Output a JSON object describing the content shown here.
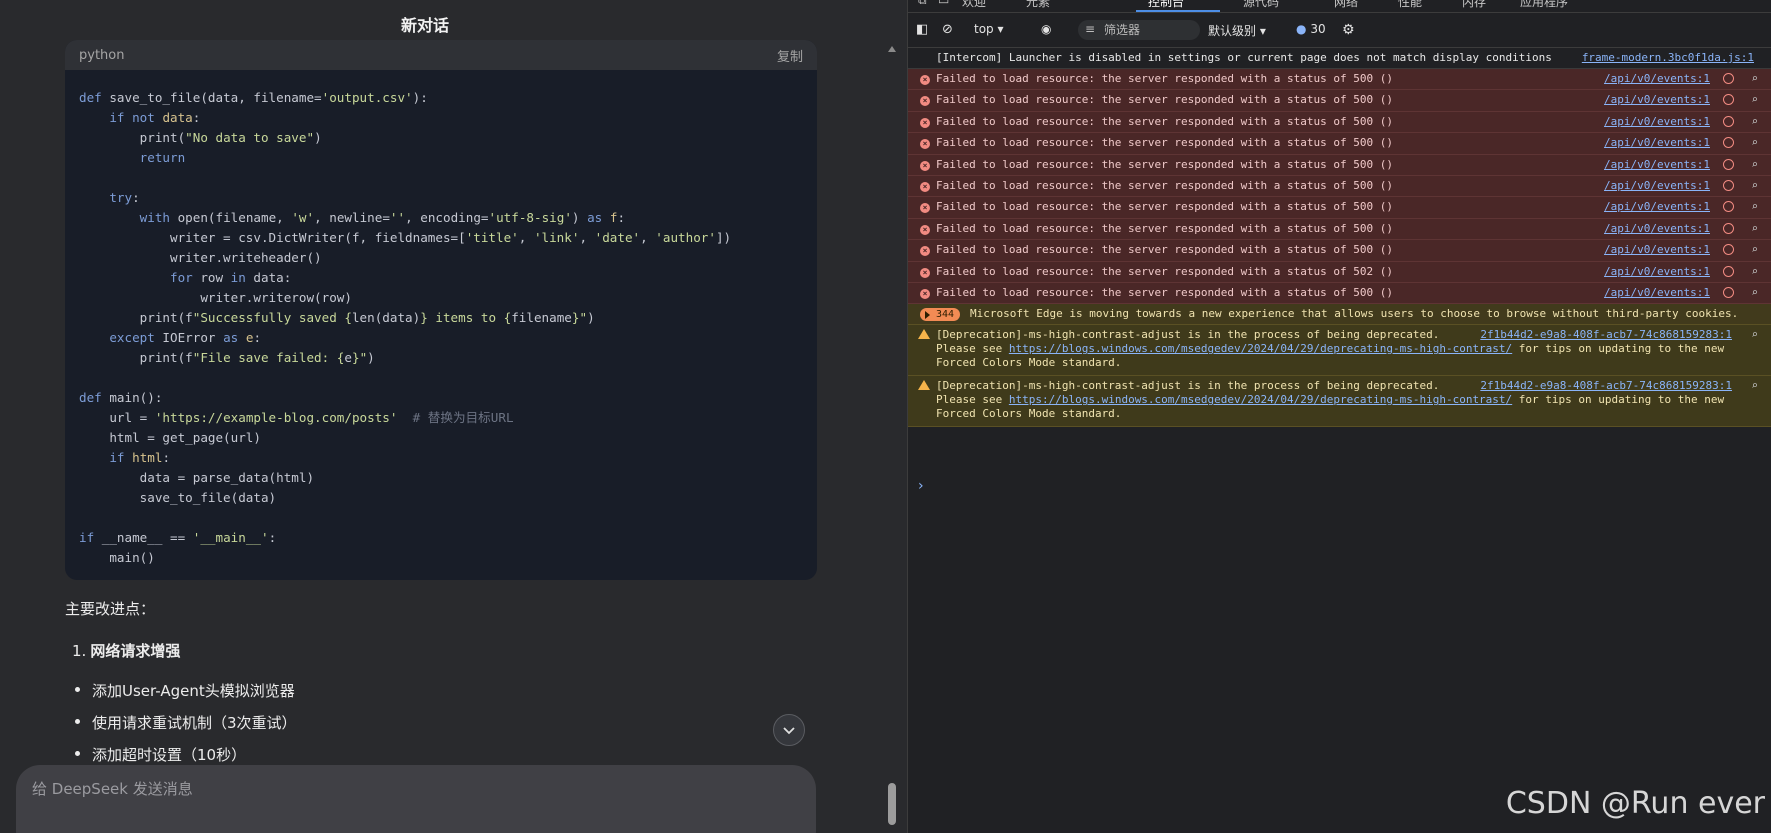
{
  "chat": {
    "title": "新对话",
    "code_block": {
      "language": "python",
      "copy_label": "复制"
    },
    "improvements_heading": "主要改进点：",
    "improvement_item": {
      "number": "1.",
      "text": "网络请求增强"
    },
    "bullets": [
      "添加User-Agent头模拟浏览器",
      "使用请求重试机制（3次重试）",
      "添加超时设置（10秒）"
    ],
    "composer_placeholder": "给 DeepSeek 发送消息"
  },
  "devtools": {
    "tabs": [
      "欢迎",
      "元素",
      "控制台",
      "源代码",
      "网络",
      "性能",
      "内存",
      "应用程序"
    ],
    "active_tab": "控制台",
    "toolbar": {
      "context": "top",
      "filter_placeholder": "筛选器",
      "level": "默认级别",
      "issues_count": "30"
    },
    "console": {
      "info": {
        "text": "[Intercom] Launcher is disabled in settings or current page does not match display conditions",
        "source": "frame-modern.3bc0f1da.js:1"
      },
      "errors": [
        {
          "text": "Failed to load resource: the server responded with a status of 500 ()",
          "source": "/api/v0/events:1"
        },
        {
          "text": "Failed to load resource: the server responded with a status of 500 ()",
          "source": "/api/v0/events:1"
        },
        {
          "text": "Failed to load resource: the server responded with a status of 500 ()",
          "source": "/api/v0/events:1"
        },
        {
          "text": "Failed to load resource: the server responded with a status of 500 ()",
          "source": "/api/v0/events:1"
        },
        {
          "text": "Failed to load resource: the server responded with a status of 500 ()",
          "source": "/api/v0/events:1"
        },
        {
          "text": "Failed to load resource: the server responded with a status of 500 ()",
          "source": "/api/v0/events:1"
        },
        {
          "text": "Failed to load resource: the server responded with a status of 500 ()",
          "source": "/api/v0/events:1"
        },
        {
          "text": "Failed to load resource: the server responded with a status of 500 ()",
          "source": "/api/v0/events:1"
        },
        {
          "text": "Failed to load resource: the server responded with a status of 500 ()",
          "source": "/api/v0/events:1"
        },
        {
          "text": "Failed to load resource: the server responded with a status of 502 ()",
          "source": "/api/v0/events:1"
        },
        {
          "text": "Failed to load resource: the server responded with a status of 500 ()",
          "source": "/api/v0/events:1"
        }
      ],
      "edge_notice": {
        "count": "344",
        "text": "Microsoft Edge is moving towards a new experience that allows users to choose to browse without third-party cookies."
      },
      "warnings": [
        {
          "line1": "[Deprecation]-ms-high-contrast-adjust is in the process of being deprecated.",
          "source": "2f1b44d2-e9a8-408f-acb7-74c868159283:1",
          "line2_prefix": "Please see ",
          "url": "https://blogs.windows.com/msedgedev/2024/04/29/deprecating-ms-high-contrast/",
          "line2_suffix": " for tips on updating to the new",
          "line3": "Forced Colors Mode standard."
        },
        {
          "line1": "[Deprecation]-ms-high-contrast-adjust is in the process of being deprecated.",
          "source": "2f1b44d2-e9a8-408f-acb7-74c868159283:1",
          "line2_prefix": "Please see ",
          "url": "https://blogs.windows.com/msedgedev/2024/04/29/deprecating-ms-high-contrast/",
          "line2_suffix": " for tips on updating to the new",
          "line3": "Forced Colors Mode standard."
        }
      ],
      "prompt_symbol": "›"
    }
  },
  "watermark": "CSDN @Run ever"
}
